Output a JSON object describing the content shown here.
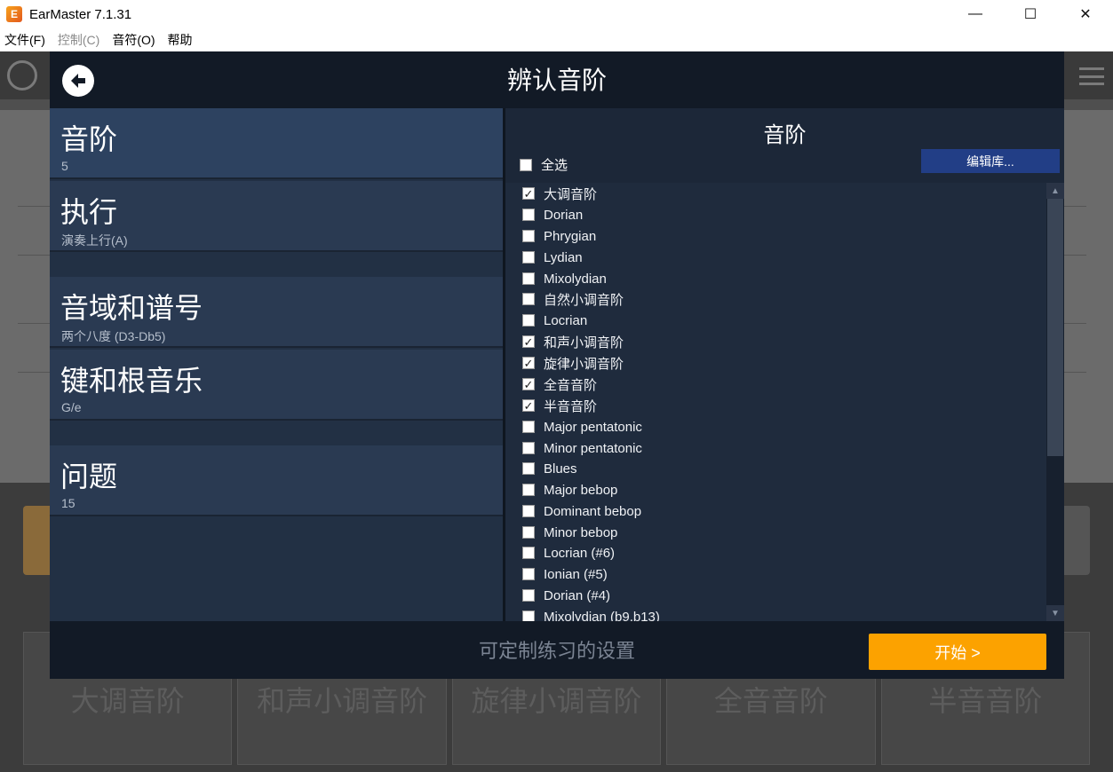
{
  "window": {
    "title": "EarMaster 7.1.31",
    "app_icon_glyph": "E",
    "controls": {
      "minimize": "—",
      "maximize": "☐",
      "close": "✕"
    }
  },
  "menu": {
    "items": [
      {
        "label": "文件(F)",
        "enabled": true
      },
      {
        "label": "控制(C)",
        "enabled": false
      },
      {
        "label": "音符(O)",
        "enabled": true
      },
      {
        "label": "帮助",
        "enabled": true
      }
    ]
  },
  "background": {
    "tiles": [
      "大调音阶",
      "和声小调音阶",
      "旋律小调音阶",
      "全音音阶",
      "半音音阶"
    ]
  },
  "dialog": {
    "title": "辨认音阶",
    "back_icon": "back-arrow-icon",
    "settings": [
      {
        "label": "音阶",
        "value": "5",
        "active": true
      },
      {
        "label": "执行",
        "value": "演奏上行(A)",
        "active": false
      },
      {
        "label": "音域和谱号",
        "value": "两个八度 (D3-Db5)",
        "active": false
      },
      {
        "label": "键和根音乐",
        "value": "G/e",
        "active": false
      },
      {
        "label": "问题",
        "value": "15",
        "active": false
      }
    ],
    "scales_panel": {
      "title": "音阶",
      "select_all_label": "全选",
      "select_all_checked": false,
      "edit_library_label": "编辑库...",
      "items": [
        {
          "label": "大调音阶",
          "checked": true
        },
        {
          "label": "Dorian",
          "checked": false
        },
        {
          "label": "Phrygian",
          "checked": false
        },
        {
          "label": "Lydian",
          "checked": false
        },
        {
          "label": "Mixolydian",
          "checked": false
        },
        {
          "label": "自然小调音阶",
          "checked": false
        },
        {
          "label": "Locrian",
          "checked": false
        },
        {
          "label": "和声小调音阶",
          "checked": true
        },
        {
          "label": "旋律小调音阶",
          "checked": true
        },
        {
          "label": "全音音阶",
          "checked": true
        },
        {
          "label": "半音音阶",
          "checked": true
        },
        {
          "label": "Major pentatonic",
          "checked": false
        },
        {
          "label": "Minor pentatonic",
          "checked": false
        },
        {
          "label": "Blues",
          "checked": false
        },
        {
          "label": "Major bebop",
          "checked": false
        },
        {
          "label": "Dominant bebop",
          "checked": false
        },
        {
          "label": "Minor bebop",
          "checked": false
        },
        {
          "label": "Locrian (#6)",
          "checked": false
        },
        {
          "label": "Ionian (#5)",
          "checked": false
        },
        {
          "label": "Dorian (#4)",
          "checked": false
        },
        {
          "label": "Mixolydian (b9,b13)",
          "checked": false
        }
      ]
    },
    "footer": {
      "text": "可定制练习的设置",
      "start_label": "开始 >"
    }
  },
  "colors": {
    "dialog_bg": "#1e2a3a",
    "header_bg": "#121a26",
    "active_setting": "#2d4260",
    "edit_button": "#223e86",
    "start_button": "#fca200"
  }
}
